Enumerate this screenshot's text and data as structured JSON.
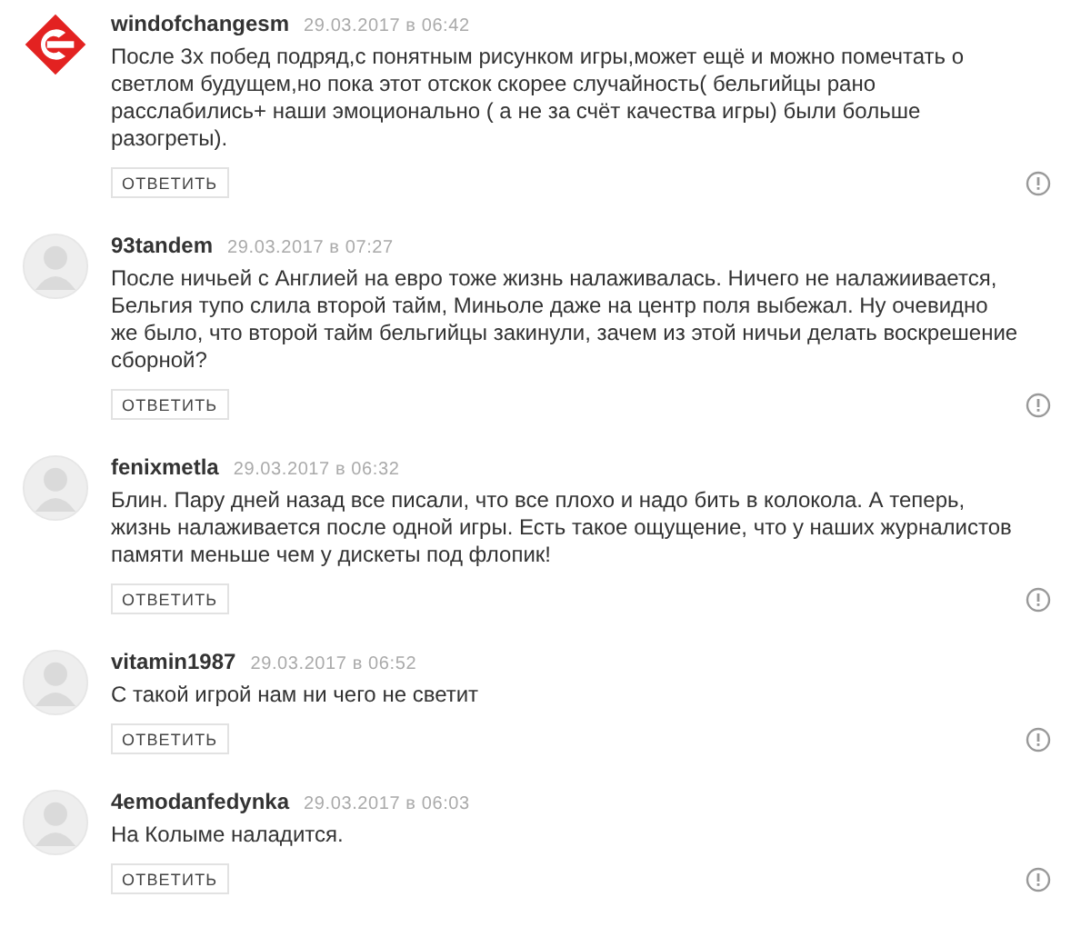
{
  "comments": [
    {
      "avatar": {
        "kind": "logo"
      },
      "author": "windofchangesm",
      "date": "29.03.2017 в 06:42",
      "text": "После 3х побед подряд,с понятным рисунком игры,может ещё и можно помечтать о светлом будущем,но пока этот отскок скорее случайность( бельгийцы рано расслабились+ наши эмоционально ( а не за счёт качества игры) были больше разогреты).",
      "reply": "ОТВЕТИТЬ"
    },
    {
      "avatar": {
        "kind": "default"
      },
      "author": "93tandem",
      "date": "29.03.2017 в 07:27",
      "text": "После ничьей с Англией на евро тоже жизнь налаживалась. Ничего не налажиивается, Бельгия тупо слила второй тайм, Миньоле даже на центр поля выбежал. Ну очевидно же было, что второй тайм бельгийцы закинули, зачем из этой ничьи делать воскрешение сборной?",
      "reply": "ОТВЕТИТЬ"
    },
    {
      "avatar": {
        "kind": "default"
      },
      "author": "fenixmetla",
      "date": "29.03.2017 в 06:32",
      "text": "Блин. Пару дней назад все писали, что все плохо и надо бить в колокола. А теперь, жизнь налаживается после одной игры. Есть такое ощущение, что у наших журналистов памяти меньше чем у дискеты под флопик!",
      "reply": "ОТВЕТИТЬ"
    },
    {
      "avatar": {
        "kind": "default"
      },
      "author": "vitamin1987",
      "date": "29.03.2017 в 06:52",
      "text": "С такой игрой нам ни чего не светит",
      "reply": "ОТВЕТИТЬ"
    },
    {
      "avatar": {
        "kind": "default"
      },
      "author": "4emodanfedynka",
      "date": "29.03.2017 в 06:03",
      "text": "На Колыме наладится.",
      "reply": "ОТВЕТИТЬ"
    }
  ]
}
